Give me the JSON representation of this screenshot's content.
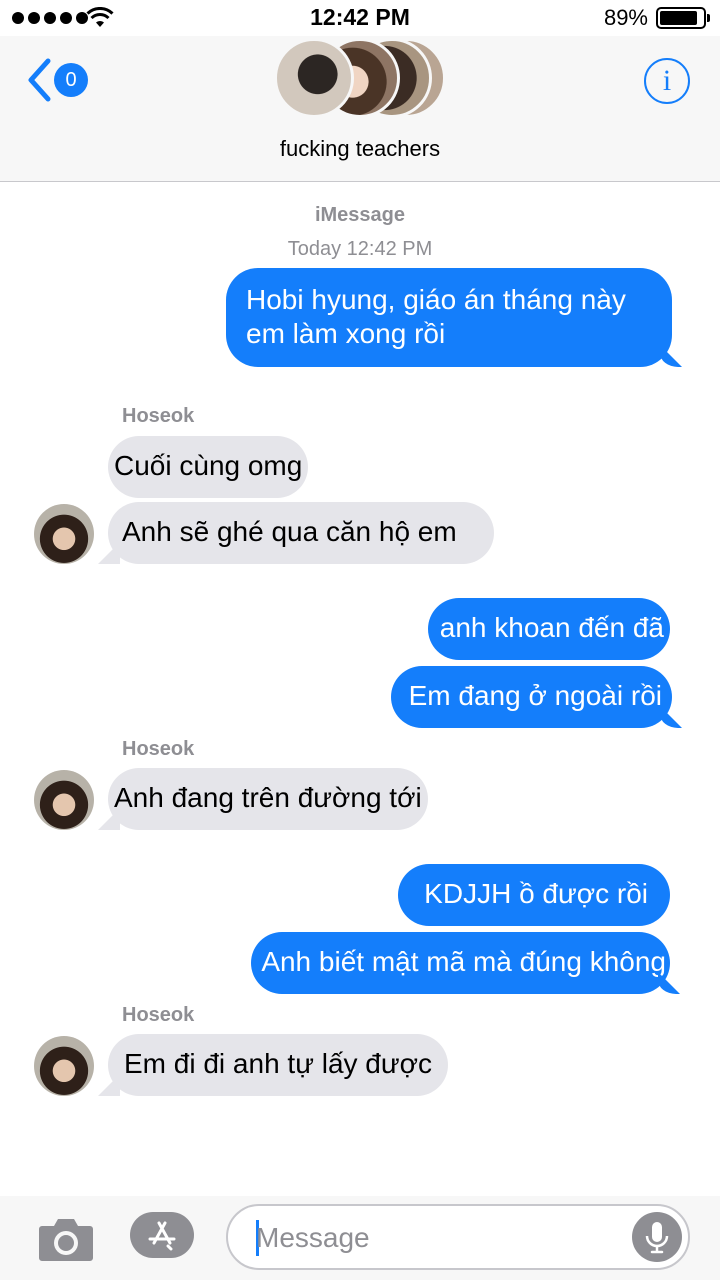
{
  "status_bar": {
    "time": "12:42 PM",
    "battery": "89%",
    "battery_level": 0.89
  },
  "header": {
    "back_count": "0",
    "group_name": "fucking teachers",
    "icons": {
      "back": "chevron-left-icon",
      "info": "info-icon"
    }
  },
  "thread": {
    "service": "iMessage",
    "timestamp": "Today 12:42 PM",
    "messages": [
      {
        "direction": "out",
        "text_lines": [
          "Hobi hyung, giáo án tháng này",
          "em làm xong rồi"
        ]
      },
      {
        "direction": "in",
        "sender": "Hoseok",
        "text": "Cuối cùng omg"
      },
      {
        "direction": "in",
        "text": "Anh sẽ ghé qua căn hộ em"
      },
      {
        "direction": "out",
        "text": "anh khoan đến đã"
      },
      {
        "direction": "out",
        "text": "Em đang ở ngoài rồi"
      },
      {
        "direction": "in",
        "sender": "Hoseok",
        "text": "Anh đang trên đường tới"
      },
      {
        "direction": "out",
        "text": "KDJJH ồ được rồi"
      },
      {
        "direction": "out",
        "text": "Anh biết mật mã mà đúng không"
      },
      {
        "direction": "in",
        "sender": "Hoseok",
        "text": "Em đi đi anh tự lấy được"
      }
    ]
  },
  "composer": {
    "placeholder": "Message",
    "icons": {
      "camera": "camera-icon",
      "apps": "app-store-icon",
      "mic": "microphone-icon"
    }
  },
  "colors": {
    "accent": "#147efb",
    "incoming_bubble": "#e5e5ea",
    "meta_text": "#8e8e93"
  }
}
